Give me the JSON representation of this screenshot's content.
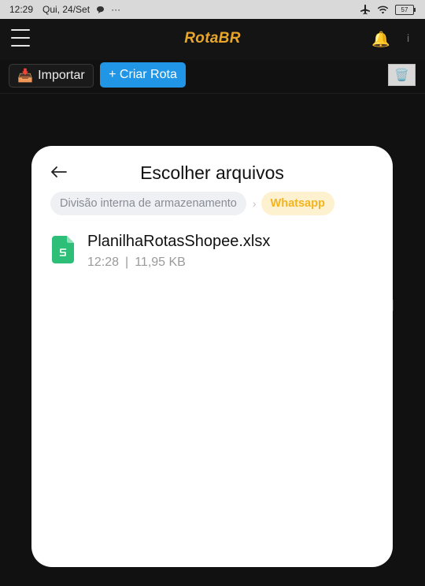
{
  "status_bar": {
    "time": "12:29",
    "date": "Qui, 24/Set",
    "extra": "···",
    "battery": "57"
  },
  "header": {
    "title": "RotaBR",
    "bell_glyph": "🔔",
    "info_glyph": "i"
  },
  "toolbar": {
    "import_icon": "📥",
    "import_label": "Importar",
    "create_label": "+ Criar Rota",
    "trash_icon": "🗑️"
  },
  "dialog": {
    "title": "Escolher arquivos",
    "breadcrumbs": [
      {
        "label": "Divisão interna de armazenamento",
        "active": false
      },
      {
        "label": "Whatsapp",
        "active": true
      }
    ],
    "crumb_separator": "›",
    "files": [
      {
        "name": "PlanilhaRotasShopee.xlsx",
        "time": "12:28",
        "separator": "|",
        "size": "11,95 KB"
      }
    ]
  },
  "colors": {
    "app_title": "#e8a72b",
    "create_button": "#2196e6",
    "breadcrumb_active_text": "#f3b420",
    "breadcrumb_active_bg": "#fdf1cf",
    "sheet_icon": "#2dbf78"
  },
  "icons": {
    "menu": "hamburger-menu-icon",
    "back": "arrow-left-icon",
    "file": "spreadsheet-file-icon",
    "notification": "bell-icon",
    "airplane": "airplane-icon",
    "wifi": "wifi-icon",
    "chat": "chat-bubble-icon"
  }
}
